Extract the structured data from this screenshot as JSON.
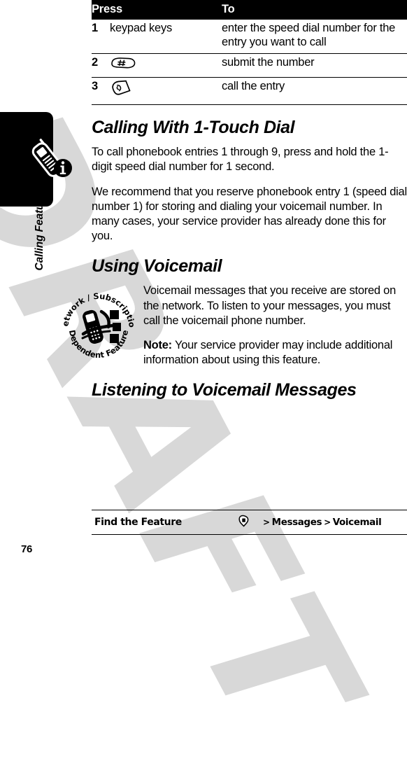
{
  "page": {
    "number": "76",
    "watermark": "DRAFT",
    "sidebar_label": "Calling Features",
    "tip_icon": "phone-info-tip-icon"
  },
  "steps_table": {
    "headers": {
      "press": "Press",
      "to": "To"
    },
    "rows": [
      {
        "num": "1",
        "press_text": "keypad keys",
        "press_icon": "",
        "to": "enter the speed dial number for the entry you want to call"
      },
      {
        "num": "2",
        "press_text": "",
        "press_icon": "pound-key-icon",
        "to": "submit the number"
      },
      {
        "num": "3",
        "press_text": "",
        "press_icon": "send-key-icon",
        "to": "call the entry"
      }
    ]
  },
  "sections": [
    {
      "heading": "Calling With 1-Touch Dial",
      "paragraphs": [
        "To call phonebook entries 1 through 9, press and hold the 1-digit speed dial number for 1 second.",
        "We recommend that you reserve phonebook entry 1 (speed dial number 1) for storing and dialing your voicemail number. In many cases, your service provider has already done this for you."
      ]
    },
    {
      "heading": "Using Voicemail",
      "stamp_icon": "network-subscription-dependent-feature-icon",
      "stamp_text": {
        "top_arc": "Network / Subscription",
        "bottom_arc": "Dependent  Feature"
      },
      "paragraphs": [
        "Voicemail messages that you receive are stored on the network. To listen to your messages, you must call the voicemail phone number."
      ],
      "note_label": "Note:",
      "note_text": " Your service provider may include additional information about using this feature."
    },
    {
      "heading": "Listening to Voicemail Messages"
    }
  ],
  "find_feature": {
    "label": "Find the Feature",
    "menu_icon": "menu-key-icon",
    "separator": ">",
    "path": [
      "Messages",
      "Voicemail"
    ]
  }
}
